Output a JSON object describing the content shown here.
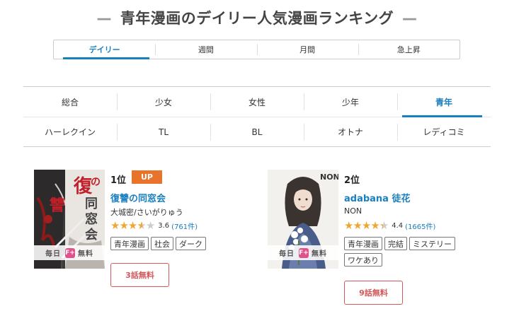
{
  "page": {
    "title": "青年漫画のデイリー人気漫画ランキング",
    "dash": "—"
  },
  "period_tabs": [
    {
      "label": "デイリー",
      "active": true
    },
    {
      "label": "週間",
      "active": false
    },
    {
      "label": "月間",
      "active": false
    },
    {
      "label": "急上昇",
      "active": false
    }
  ],
  "genres": {
    "row1": [
      {
        "label": "総合",
        "active": false
      },
      {
        "label": "少女",
        "active": false
      },
      {
        "label": "女性",
        "active": false
      },
      {
        "label": "少年",
        "active": false
      },
      {
        "label": "青年",
        "active": true
      }
    ],
    "row2": [
      {
        "label": "ハーレクイン",
        "active": false
      },
      {
        "label": "TL",
        "active": false
      },
      {
        "label": "BL",
        "active": false
      },
      {
        "label": "オトナ",
        "active": false
      },
      {
        "label": "レディコミ",
        "active": false
      }
    ]
  },
  "items": [
    {
      "rank": "1位",
      "badge": "UP",
      "title": "復讐の同窓会",
      "author": "大城密/さいがりゅう",
      "rating": {
        "stars": 3.6,
        "score": "3.6",
        "count": "(761件)"
      },
      "tags": [
        "青年漫画",
        "社会",
        "ダーク"
      ],
      "free_label": "3話無料",
      "cover": {
        "strip_left": "毎日",
        "strip_icon": "F+",
        "strip_right": "無料",
        "title_text": "復讐の同窓会"
      }
    },
    {
      "rank": "2位",
      "badge": "",
      "title": "adabana 徒花",
      "author": "NON",
      "rating": {
        "stars": 4.4,
        "score": "4.4",
        "count": "(1665件)"
      },
      "tags": [
        "青年漫画",
        "完結",
        "ミステリー",
        "ワケあり"
      ],
      "free_label": "9話無料",
      "cover": {
        "strip_left": "毎日",
        "strip_icon": "F+",
        "strip_right": "無料",
        "title_text": "NON"
      }
    }
  ],
  "colors": {
    "accent": "#1a7fbf",
    "badge_up": "#e8732b",
    "free_button": "#d3585b",
    "star": "#f0a732"
  },
  "icons": {
    "cover_badge": "free-plus-icon",
    "star": "star-icon"
  }
}
